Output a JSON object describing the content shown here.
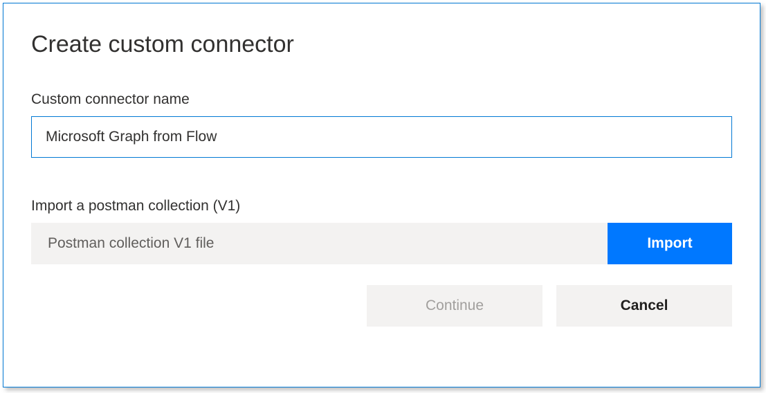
{
  "dialog": {
    "title": "Create custom connector"
  },
  "connectorName": {
    "label": "Custom connector name",
    "value": "Microsoft Graph from Flow"
  },
  "import": {
    "label": "Import a postman collection (V1)",
    "placeholder": "Postman collection V1 file",
    "buttonLabel": "Import"
  },
  "actions": {
    "continue": "Continue",
    "cancel": "Cancel"
  }
}
